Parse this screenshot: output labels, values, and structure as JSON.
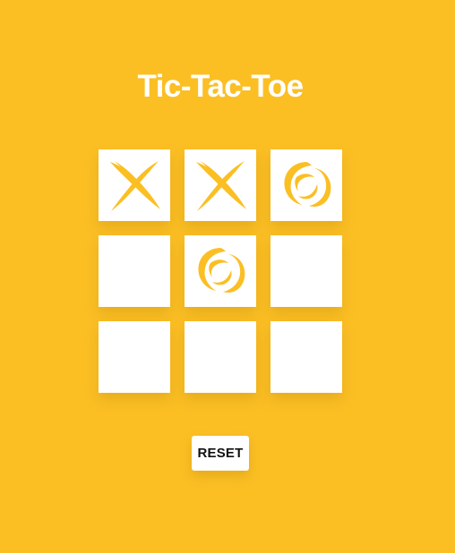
{
  "title": "Tic-Tac-Toe",
  "board": [
    "X",
    "X",
    "O",
    "",
    "O",
    "",
    "",
    "",
    ""
  ],
  "reset_label": "RESET",
  "colors": {
    "background": "#FBBF24",
    "mark": "#FBBF24",
    "cell": "#FFFFFF"
  }
}
